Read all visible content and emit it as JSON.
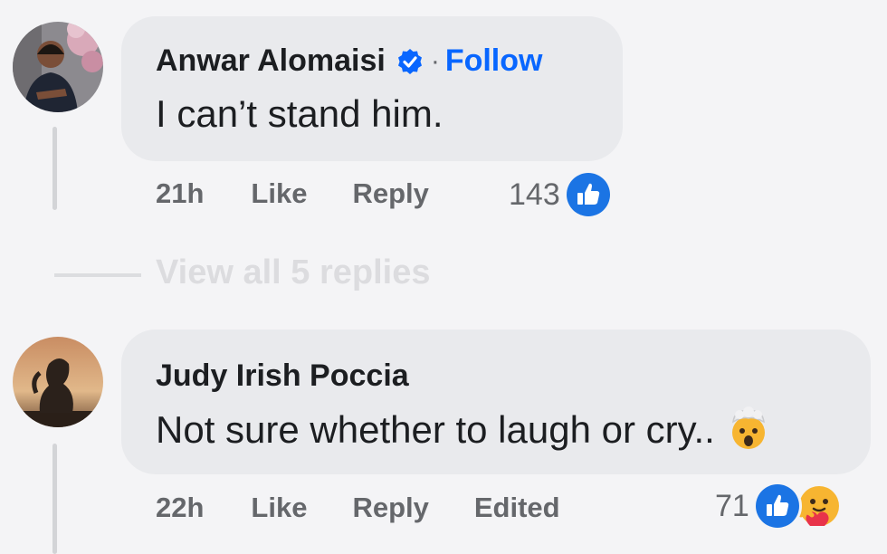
{
  "colors": {
    "background": "#f4f4f6",
    "bubble": "#e9eaed",
    "primary_text": "#1c1e21",
    "secondary_text": "#65676b",
    "link_blue": "#0866ff"
  },
  "comments": [
    {
      "avatar": "avatar-photo-man-flowers",
      "author": "Anwar Alomaisi",
      "verified_icon": "verified-badge-icon",
      "separator": "·",
      "follow_label": "Follow",
      "text": "I can’t stand him.",
      "time": "21h",
      "like_label": "Like",
      "reply_label": "Reply",
      "reaction_count": "143",
      "reactions": [
        "like-reaction-icon"
      ]
    },
    {
      "avatar": "avatar-photo-woman-sunset",
      "author": "Judy Irish Poccia",
      "text": "Not sure whether to laugh or cry..",
      "text_emoji": "mind-blown-emoji",
      "time": "22h",
      "like_label": "Like",
      "reply_label": "Reply",
      "edited_label": "Edited",
      "reaction_count": "71",
      "reactions": [
        "like-reaction-icon",
        "care-reaction-icon"
      ]
    }
  ],
  "view_replies": {
    "label": "View all 5 replies"
  }
}
